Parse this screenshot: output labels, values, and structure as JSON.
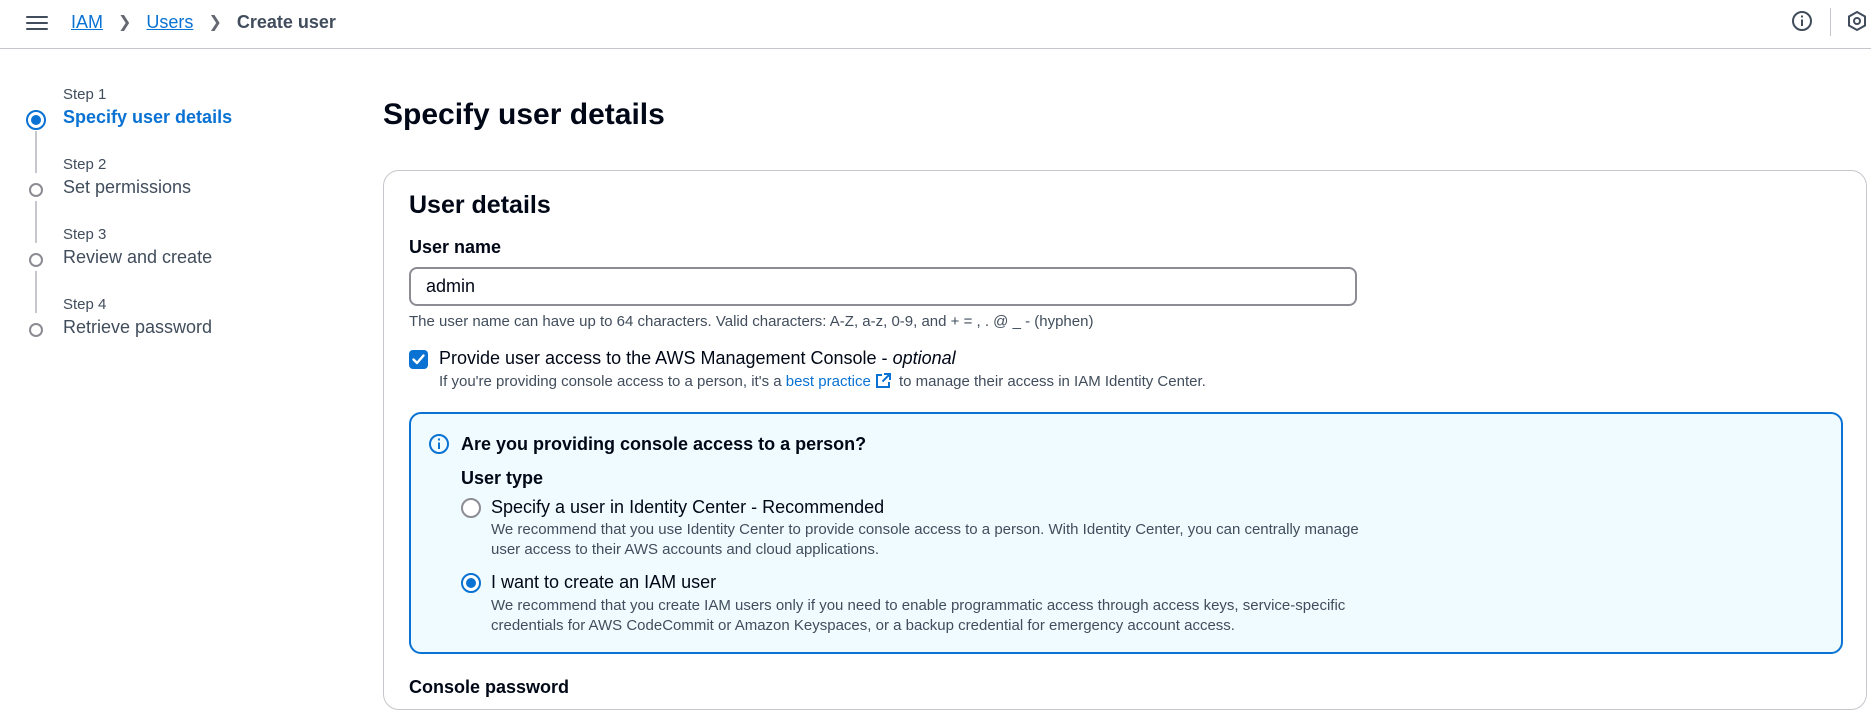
{
  "topbar": {
    "menu_icon": "hamburger-menu-icon",
    "breadcrumbs": [
      {
        "label": "IAM"
      },
      {
        "label": "Users"
      },
      {
        "label": "Create user"
      }
    ],
    "info_icon": "info-circle-icon",
    "settings_icon": "settings-hexagon-icon"
  },
  "wizard": {
    "steps": [
      {
        "number": "Step 1",
        "title": "Specify user details",
        "active": true
      },
      {
        "number": "Step 2",
        "title": "Set permissions",
        "active": false
      },
      {
        "number": "Step 3",
        "title": "Review and create",
        "active": false
      },
      {
        "number": "Step 4",
        "title": "Retrieve password",
        "active": false
      }
    ]
  },
  "main": {
    "page_title": "Specify user details",
    "section_title": "User details",
    "user_name": {
      "label": "User name",
      "value": "admin",
      "constraint": "The user name can have up to 64 characters. Valid characters: A-Z, a-z, 0-9, and + = , . @ _ - (hyphen)"
    },
    "console_access": {
      "checked": true,
      "label": "Provide user access to the AWS Management Console - ",
      "label_optional": "optional",
      "desc_before": "If you're providing console access to a person, it's a ",
      "desc_link": "best practice",
      "desc_after": " to manage their access in IAM Identity Center."
    },
    "alert": {
      "icon": "info-circle-icon",
      "title": "Are you providing console access to a person?",
      "user_type_label": "User type",
      "options": [
        {
          "label": "Specify a user in Identity Center - Recommended",
          "description": "We recommend that you use Identity Center to provide console access to a person. With Identity Center, you can centrally manage user access to their AWS accounts and cloud applications.",
          "selected": false
        },
        {
          "label": "I want to create an IAM user",
          "description": "We recommend that you create IAM users only if you need to enable programmatic access through access keys, service-specific credentials for AWS CodeCommit or Amazon Keyspaces, or a backup credential for emergency account access.",
          "selected": true
        }
      ]
    },
    "next_section_partial": "Console password"
  },
  "colors": {
    "accent": "#0972d3",
    "alert_bg": "#f0fbff",
    "text": "#000716",
    "muted": "#414d5c"
  }
}
